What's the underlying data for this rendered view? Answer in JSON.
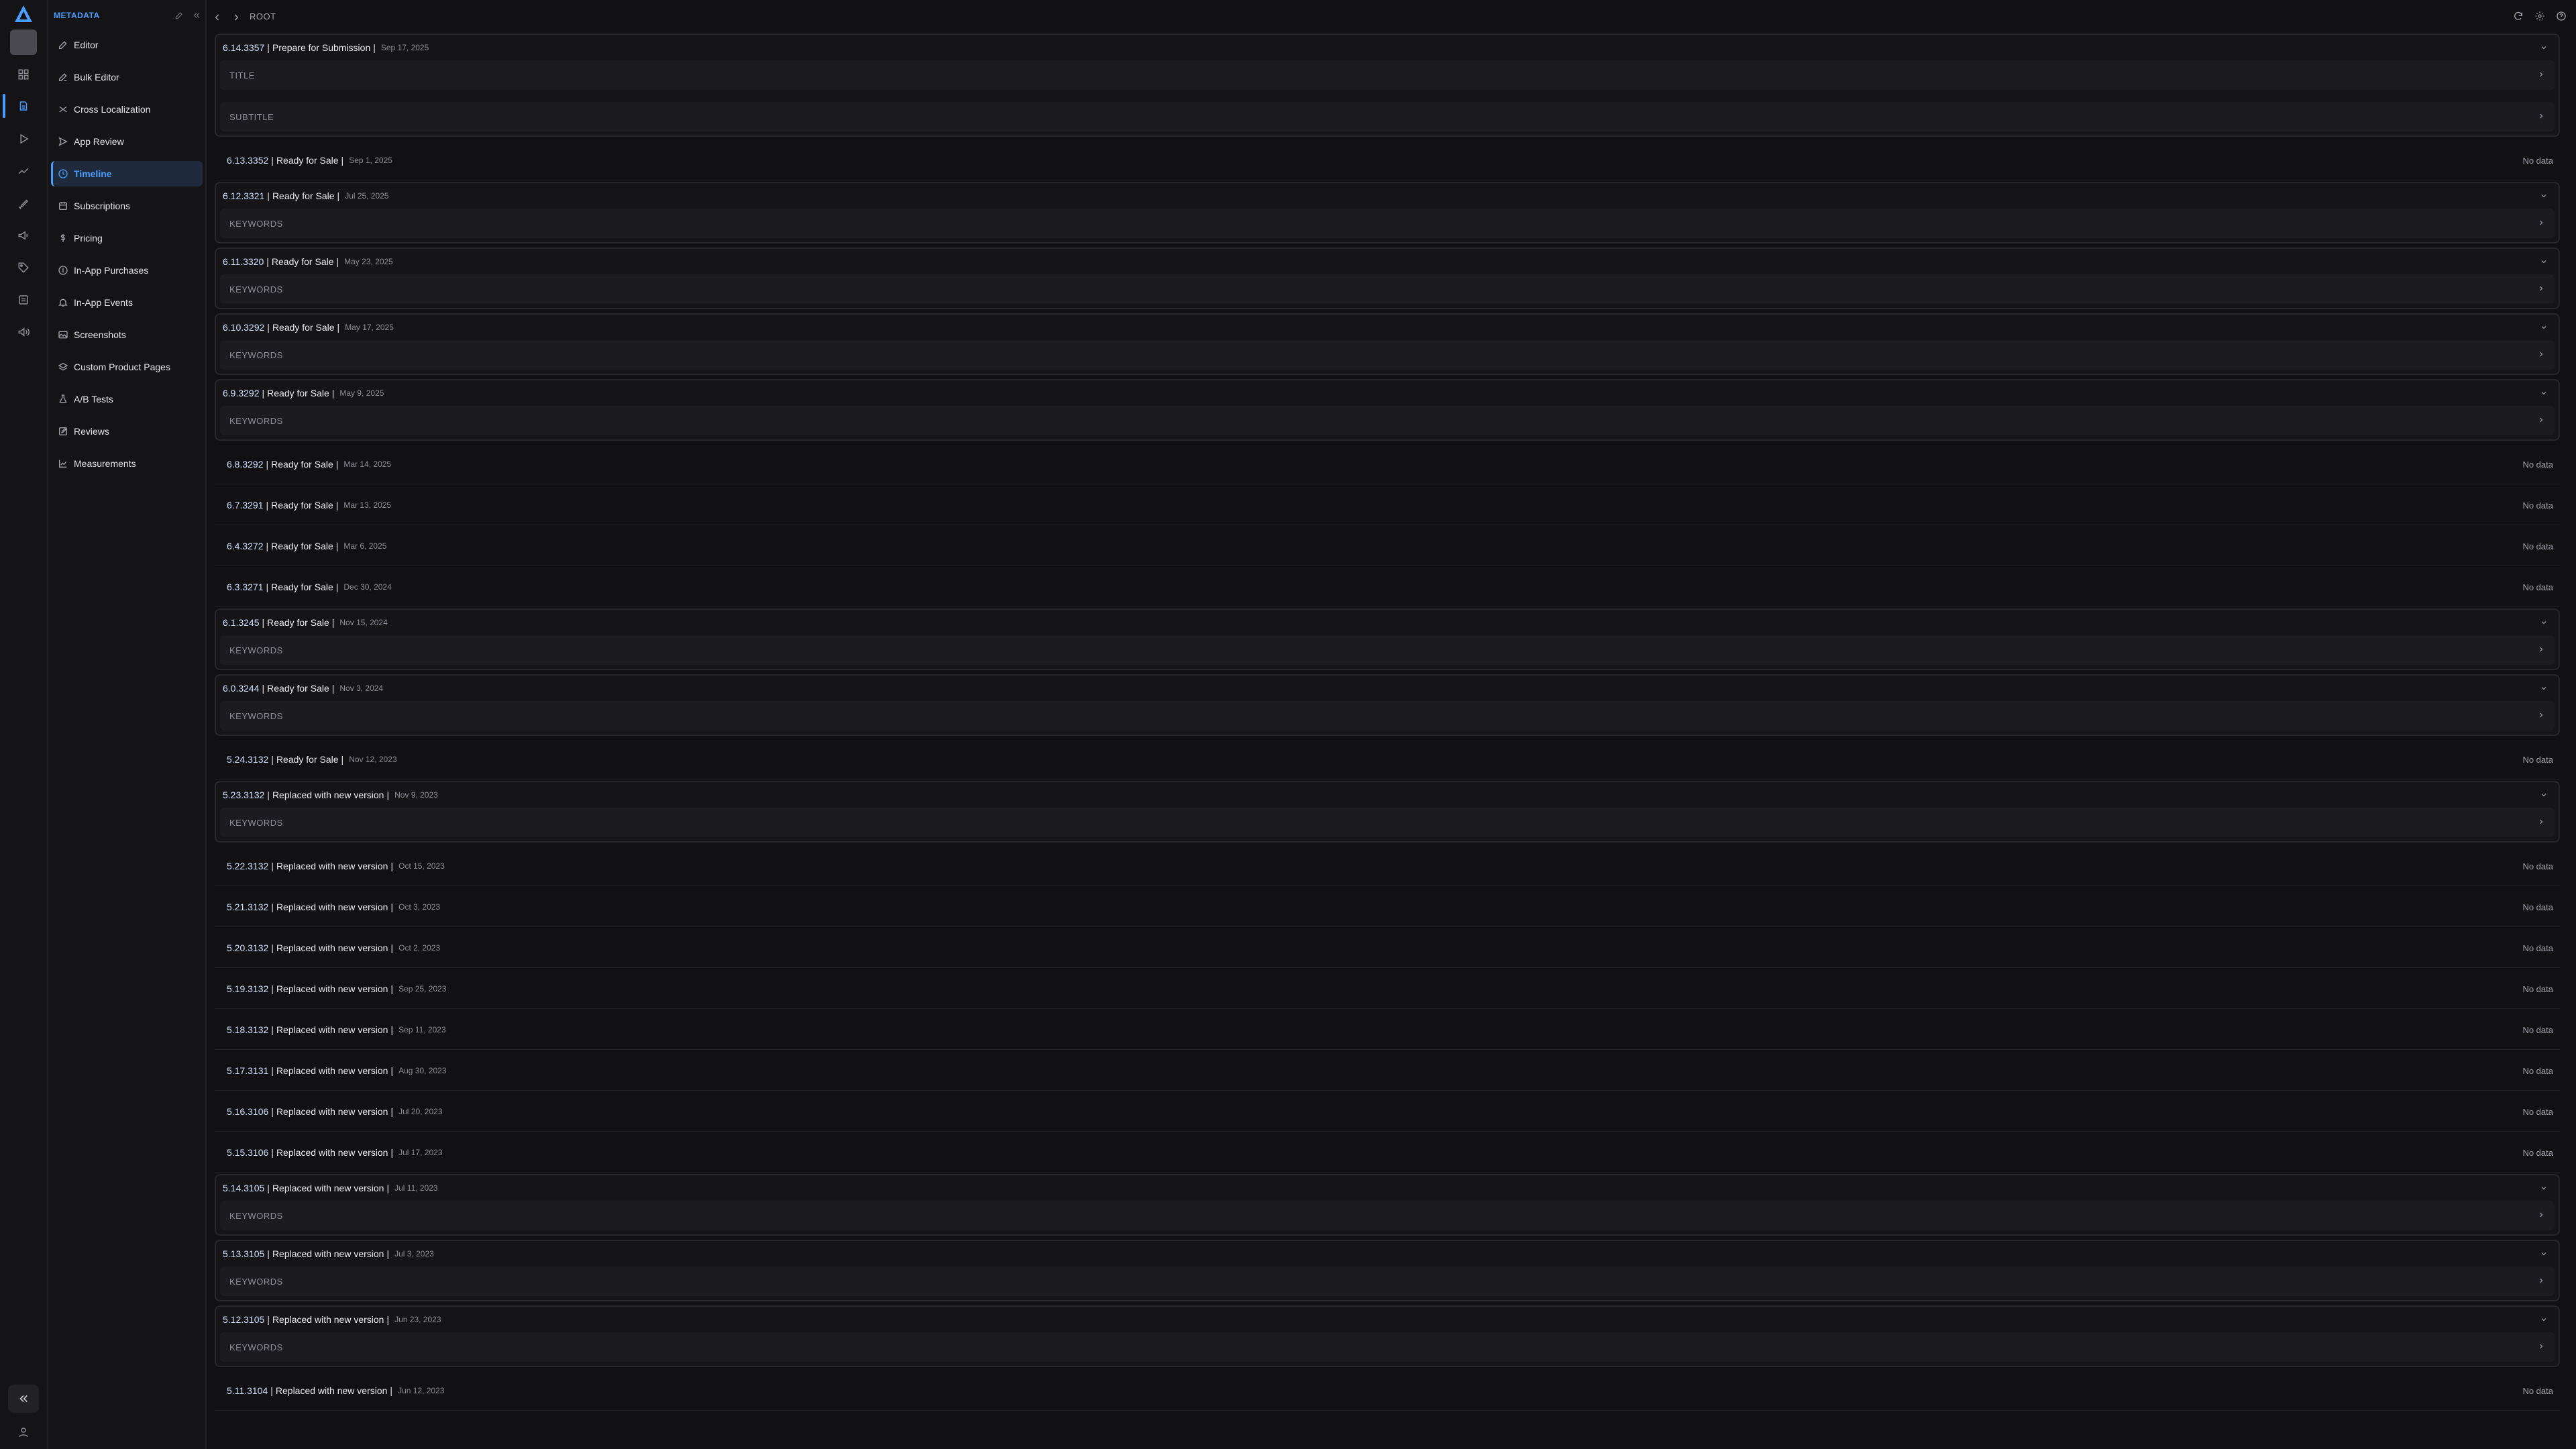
{
  "sidebar": {
    "title": "METADATA",
    "items": [
      {
        "label": "Editor",
        "icon": "pencil-icon"
      },
      {
        "label": "Bulk Editor",
        "icon": "bulk-edit-icon"
      },
      {
        "label": "Cross Localization",
        "icon": "shuffle-icon"
      },
      {
        "label": "App Review",
        "icon": "send-icon"
      },
      {
        "label": "Timeline",
        "icon": "clock-icon",
        "active": true
      },
      {
        "label": "Subscriptions",
        "icon": "calendar-icon"
      },
      {
        "label": "Pricing",
        "icon": "dollar-icon"
      },
      {
        "label": "In-App Purchases",
        "icon": "coin-icon"
      },
      {
        "label": "In-App Events",
        "icon": "bell-icon"
      },
      {
        "label": "Screenshots",
        "icon": "image-icon"
      },
      {
        "label": "Custom Product Pages",
        "icon": "layers-icon"
      },
      {
        "label": "A/B Tests",
        "icon": "flask-icon"
      },
      {
        "label": "Reviews",
        "icon": "edit-box-icon"
      },
      {
        "label": "Measurements",
        "icon": "chart-icon"
      }
    ]
  },
  "topbar": {
    "breadcrumb": "ROOT"
  },
  "colors": {
    "accent": "#4a9dff",
    "background": "#111114"
  },
  "rows": [
    {
      "version": "6.14.3357",
      "status": "Prepare for Submission",
      "date": "Sep 17, 2025",
      "expanded": true,
      "fields": [
        "TITLE",
        "SUBTITLE"
      ]
    },
    {
      "version": "6.13.3352",
      "status": "Ready for Sale",
      "date": "Sep 1, 2025",
      "expanded": false,
      "right": "No data"
    },
    {
      "version": "6.12.3321",
      "status": "Ready for Sale",
      "date": "Jul 25, 2025",
      "expanded": true,
      "fields": [
        "KEYWORDS"
      ]
    },
    {
      "version": "6.11.3320",
      "status": "Ready for Sale",
      "date": "May 23, 2025",
      "expanded": true,
      "fields": [
        "KEYWORDS"
      ]
    },
    {
      "version": "6.10.3292",
      "status": "Ready for Sale",
      "date": "May 17, 2025",
      "expanded": true,
      "fields": [
        "KEYWORDS"
      ]
    },
    {
      "version": "6.9.3292",
      "status": "Ready for Sale",
      "date": "May 9, 2025",
      "expanded": true,
      "fields": [
        "KEYWORDS"
      ]
    },
    {
      "version": "6.8.3292",
      "status": "Ready for Sale",
      "date": "Mar 14, 2025",
      "expanded": false,
      "right": "No data"
    },
    {
      "version": "6.7.3291",
      "status": "Ready for Sale",
      "date": "Mar 13, 2025",
      "expanded": false,
      "right": "No data"
    },
    {
      "version": "6.4.3272",
      "status": "Ready for Sale",
      "date": "Mar 6, 2025",
      "expanded": false,
      "right": "No data"
    },
    {
      "version": "6.3.3271",
      "status": "Ready for Sale",
      "date": "Dec 30, 2024",
      "expanded": false,
      "right": "No data"
    },
    {
      "version": "6.1.3245",
      "status": "Ready for Sale",
      "date": "Nov 15, 2024",
      "expanded": true,
      "fields": [
        "KEYWORDS"
      ]
    },
    {
      "version": "6.0.3244",
      "status": "Ready for Sale",
      "date": "Nov 3, 2024",
      "expanded": true,
      "fields": [
        "KEYWORDS"
      ]
    },
    {
      "version": "5.24.3132",
      "status": "Ready for Sale",
      "date": "Nov 12, 2023",
      "expanded": false,
      "right": "No data"
    },
    {
      "version": "5.23.3132",
      "status": "Replaced with new version",
      "date": "Nov 9, 2023",
      "expanded": true,
      "fields": [
        "KEYWORDS"
      ]
    },
    {
      "version": "5.22.3132",
      "status": "Replaced with new version",
      "date": "Oct 15, 2023",
      "expanded": false,
      "right": "No data"
    },
    {
      "version": "5.21.3132",
      "status": "Replaced with new version",
      "date": "Oct 3, 2023",
      "expanded": false,
      "right": "No data"
    },
    {
      "version": "5.20.3132",
      "status": "Replaced with new version",
      "date": "Oct 2, 2023",
      "expanded": false,
      "right": "No data"
    },
    {
      "version": "5.19.3132",
      "status": "Replaced with new version",
      "date": "Sep 25, 2023",
      "expanded": false,
      "right": "No data"
    },
    {
      "version": "5.18.3132",
      "status": "Replaced with new version",
      "date": "Sep 11, 2023",
      "expanded": false,
      "right": "No data"
    },
    {
      "version": "5.17.3131",
      "status": "Replaced with new version",
      "date": "Aug 30, 2023",
      "expanded": false,
      "right": "No data"
    },
    {
      "version": "5.16.3106",
      "status": "Replaced with new version",
      "date": "Jul 20, 2023",
      "expanded": false,
      "right": "No data"
    },
    {
      "version": "5.15.3106",
      "status": "Replaced with new version",
      "date": "Jul 17, 2023",
      "expanded": false,
      "right": "No data"
    },
    {
      "version": "5.14.3105",
      "status": "Replaced with new version",
      "date": "Jul 11, 2023",
      "expanded": true,
      "fields": [
        "KEYWORDS"
      ]
    },
    {
      "version": "5.13.3105",
      "status": "Replaced with new version",
      "date": "Jul 3, 2023",
      "expanded": true,
      "fields": [
        "KEYWORDS"
      ]
    },
    {
      "version": "5.12.3105",
      "status": "Replaced with new version",
      "date": "Jun 23, 2023",
      "expanded": true,
      "fields": [
        "KEYWORDS"
      ]
    },
    {
      "version": "5.11.3104",
      "status": "Replaced with new version",
      "date": "Jun 12, 2023",
      "expanded": false,
      "right": "No data"
    }
  ]
}
